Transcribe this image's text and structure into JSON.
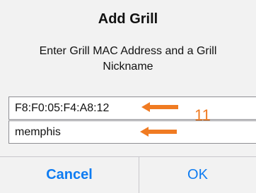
{
  "dialog": {
    "title": "Add Grill",
    "message": "Enter Grill MAC Address and a Grill Nickname",
    "mac_field": {
      "value": "F8:F0:05:F4:A8:12"
    },
    "nickname_field": {
      "value": "memphis"
    },
    "buttons": {
      "cancel_label": "Cancel",
      "ok_label": "OK"
    }
  },
  "annotation": {
    "step_number": "11",
    "color": "#f07b22"
  },
  "colors": {
    "accent": "#0e7cf2",
    "dialog_background": "#f2f2f2"
  },
  "icons": {
    "annotation_arrow": "arrow-left-icon"
  }
}
